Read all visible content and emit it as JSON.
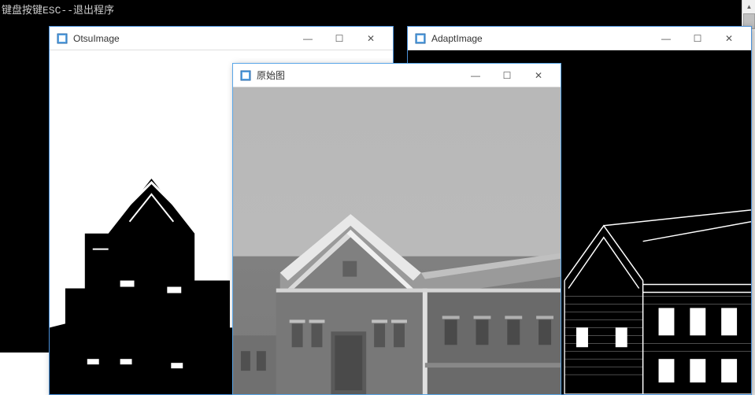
{
  "console": {
    "text": "键盘按键ESC--退出程序"
  },
  "windows": {
    "otsu": {
      "title": "OtsuImage"
    },
    "adapt": {
      "title": "AdaptImage"
    },
    "original": {
      "title": "原始图"
    }
  },
  "controls": {
    "minimize": "—",
    "maximize": "☐",
    "close": "✕"
  },
  "scrollbar": {
    "up": "▲"
  }
}
